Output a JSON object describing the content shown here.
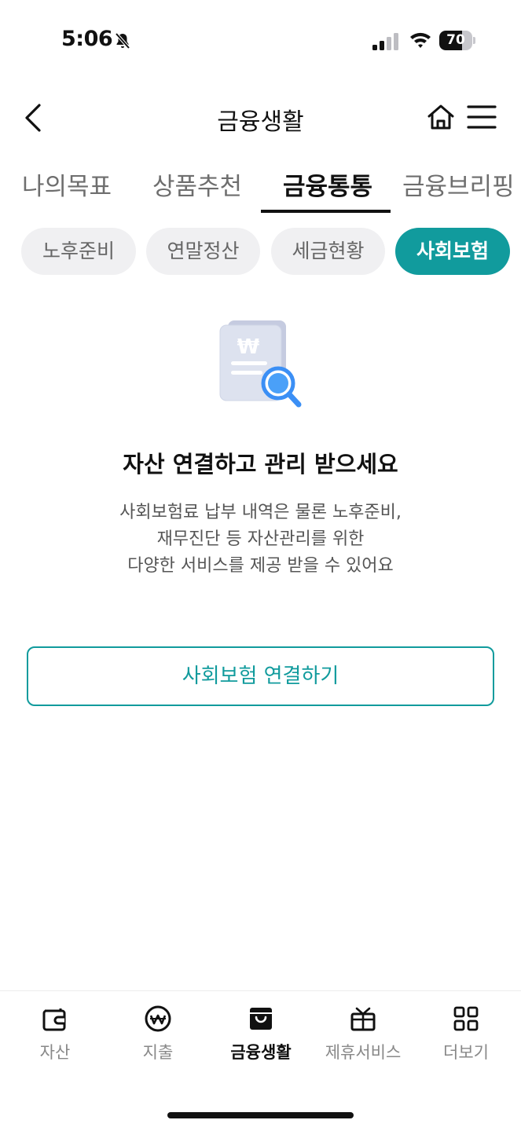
{
  "status_bar": {
    "time": "5:06",
    "battery_level": "70",
    "battery_fraction": 0.7
  },
  "header": {
    "title": "금융생활"
  },
  "tabs": [
    {
      "label": "나의목표",
      "active": false
    },
    {
      "label": "상품추천",
      "active": false
    },
    {
      "label": "금융통통",
      "active": true
    },
    {
      "label": "금융브리핑",
      "active": false
    }
  ],
  "chips": [
    {
      "label": "노후준비",
      "active": false
    },
    {
      "label": "연말정산",
      "active": false
    },
    {
      "label": "세금현황",
      "active": false
    },
    {
      "label": "사회보험",
      "active": true
    }
  ],
  "empty_state": {
    "headline": "자산 연결하고 관리 받으세요",
    "description_lines": [
      "사회보험료 납부 내역은 물론 노후준비,",
      "재무진단 등 자산관리를 위한",
      "다양한 서비스를 제공 받을 수 있어요"
    ],
    "button_label": "사회보험 연결하기"
  },
  "bottom_nav": [
    {
      "label": "자산",
      "icon": "wallet-icon",
      "active": false
    },
    {
      "label": "지출",
      "icon": "won-circle-icon",
      "active": false
    },
    {
      "label": "금융생활",
      "icon": "shopping-bag-icon",
      "active": true
    },
    {
      "label": "제휴서비스",
      "icon": "gift-icon",
      "active": false
    },
    {
      "label": "더보기",
      "icon": "grid-icon",
      "active": false
    }
  ],
  "colors": {
    "accent": "#119b9d",
    "chip_bg": "#f0f0f2",
    "text_primary": "#111111",
    "text_secondary": "#555555"
  }
}
